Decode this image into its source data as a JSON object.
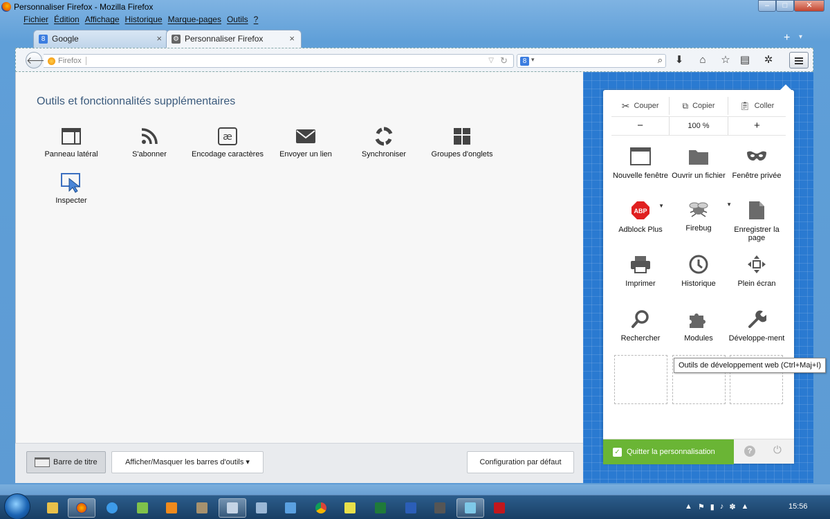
{
  "window": {
    "title": "Personnaliser Firefox - Mozilla Firefox",
    "buttons": [
      "–",
      "□",
      "✕"
    ]
  },
  "menubar": [
    "Fichier",
    "Édition",
    "Affichage",
    "Historique",
    "Marque-pages",
    "Outils",
    "?"
  ],
  "tabs": [
    {
      "label": "Google",
      "icon": "google-icon"
    },
    {
      "label": "Personnaliser Firefox",
      "icon": "customize-icon"
    }
  ],
  "newtab": "+",
  "navbar": {
    "url_label": "Firefox"
  },
  "content": {
    "heading": "Outils et fonctionnalités supplémentaires",
    "palette": [
      {
        "label": "Panneau latéral",
        "icon": "sidebar-icon"
      },
      {
        "label": "S'abonner",
        "icon": "rss-icon"
      },
      {
        "label": "Encodage caractères",
        "icon": "encoding-icon"
      },
      {
        "label": "Envoyer un lien",
        "icon": "email-icon"
      },
      {
        "label": "Synchroniser",
        "icon": "sync-icon"
      },
      {
        "label": "Groupes d'onglets",
        "icon": "tab-groups-icon"
      },
      {
        "label": "Inspecter",
        "icon": "inspect-icon"
      }
    ]
  },
  "footer": {
    "titlebar_btn": "Barre de titre",
    "toolbars_btn": "Afficher/Masquer les barres d'outils",
    "reset_btn": "Configuration par défaut"
  },
  "panel": {
    "cut": "Couper",
    "copy": "Copier",
    "paste": "Coller",
    "zoom_out": "−",
    "zoom": "100 %",
    "zoom_in": "+",
    "items": [
      {
        "label": "Nouvelle fenêtre",
        "icon": "new-window-icon"
      },
      {
        "label": "Ouvrir un fichier",
        "icon": "folder-icon"
      },
      {
        "label": "Fenêtre privée",
        "icon": "private-mask-icon"
      },
      {
        "label": "Adblock Plus",
        "icon": "abp-icon"
      },
      {
        "label": "Firebug",
        "icon": "firebug-icon"
      },
      {
        "label": "Enregistrer la page",
        "icon": "save-page-icon"
      },
      {
        "label": "Imprimer",
        "icon": "printer-icon"
      },
      {
        "label": "Historique",
        "icon": "history-clock-icon"
      },
      {
        "label": "Plein écran",
        "icon": "fullscreen-icon"
      },
      {
        "label": "Rechercher",
        "icon": "search-icon"
      },
      {
        "label": "Modules",
        "icon": "addons-puzzle-icon"
      },
      {
        "label": "Développe-ment",
        "icon": "wrench-icon"
      }
    ],
    "quit": "Quitter la personnalisation",
    "abp_text": "ABP"
  },
  "tooltip": "Outils de développement web (Ctrl+Maj+I)",
  "taskbar": {
    "clock": "15:56"
  },
  "colors": {
    "accent_green": "#6ab535",
    "blueprint": "#2a7ad1",
    "heading": "#3a5a7c"
  }
}
